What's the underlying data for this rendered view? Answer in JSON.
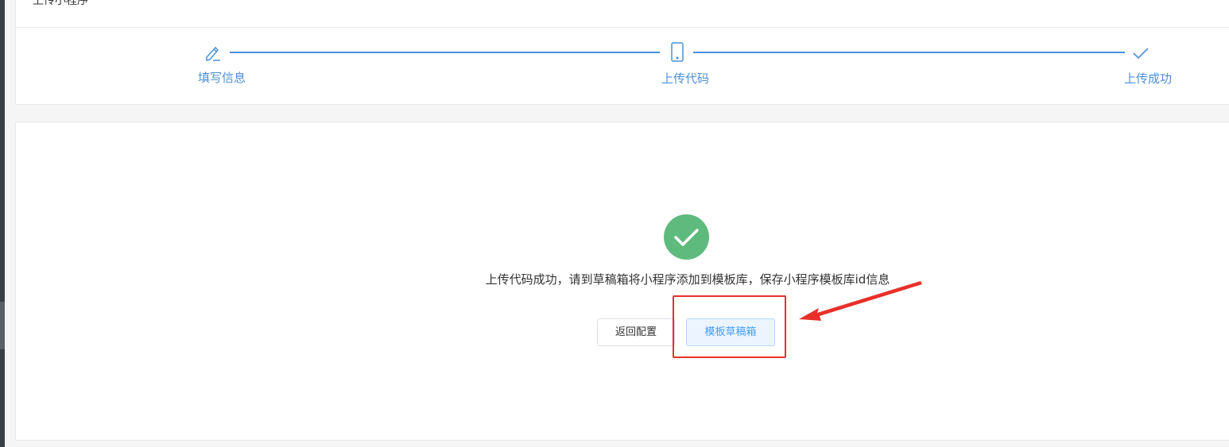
{
  "page": {
    "title": "上传小程序"
  },
  "steps": [
    {
      "label": "填写信息",
      "icon": "pencil-icon"
    },
    {
      "label": "上传代码",
      "icon": "phone-icon"
    },
    {
      "label": "上传成功",
      "icon": "check-icon"
    }
  ],
  "result": {
    "icon": "success-check-icon",
    "message": "上传代码成功，请到草稿箱将小程序添加到模板库，保存小程序模板库id信息",
    "back_button": "返回配置",
    "draft_button": "模板草稿箱"
  },
  "colors": {
    "step_accent": "#4a90d9",
    "success": "#5fba7d",
    "primary_light_bg": "#ecf5ff",
    "primary_text": "#409eff",
    "annotation_red": "#e8302a"
  }
}
